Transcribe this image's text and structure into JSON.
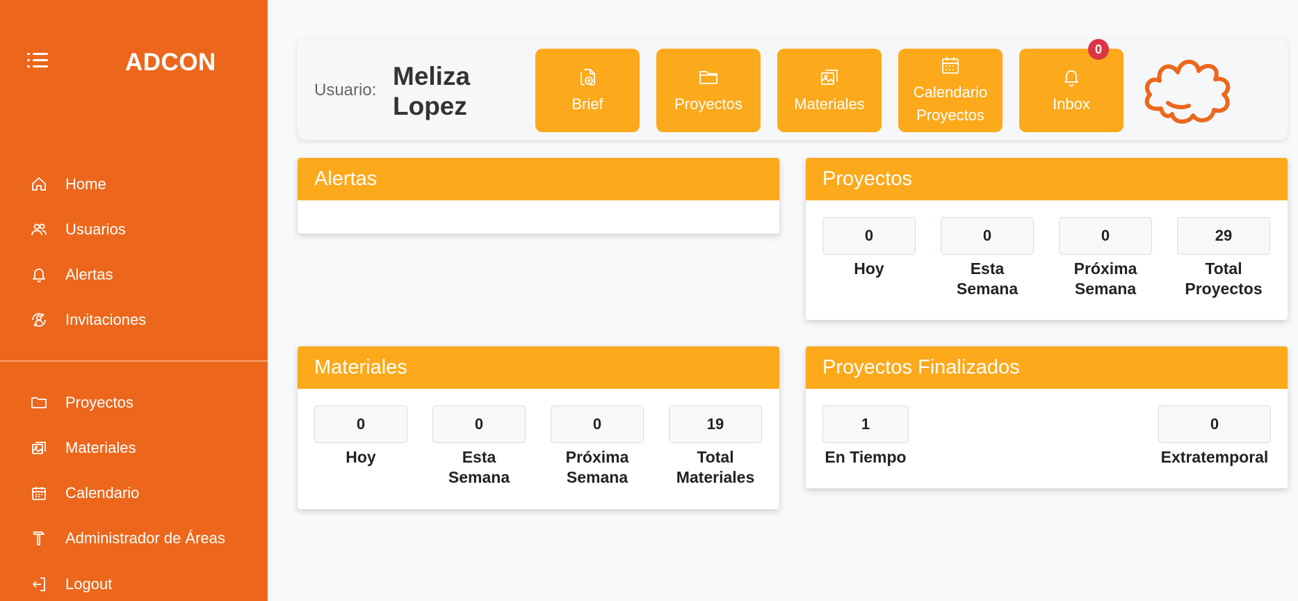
{
  "sidebar": {
    "brand": "ADCON",
    "menu_icon": "hamburger-menu-icon",
    "items_top": [
      {
        "label": "Home",
        "icon": "home-icon"
      },
      {
        "label": "Usuarios",
        "icon": "users-icon"
      },
      {
        "label": "Alertas",
        "icon": "bell-icon"
      },
      {
        "label": "Invitaciones",
        "icon": "invitations-icon"
      }
    ],
    "items_bottom": [
      {
        "label": "Proyectos",
        "icon": "folder-icon"
      },
      {
        "label": "Materiales",
        "icon": "images-icon"
      },
      {
        "label": "Calendario",
        "icon": "calendar-icon"
      },
      {
        "label": "Administrador de Áreas",
        "icon": "hammer-icon"
      },
      {
        "label": "Logout",
        "icon": "logout-icon"
      }
    ]
  },
  "header": {
    "user_label": "Usuario:",
    "user_name": "Meliza Lopez",
    "buttons": [
      {
        "label": "Brief",
        "icon": "file-add-icon"
      },
      {
        "label": "Proyectos",
        "icon": "folder-icon"
      },
      {
        "label": "Materiales",
        "icon": "images-icon"
      },
      {
        "label": "Calendario Proyectos",
        "icon": "calendar-icon"
      },
      {
        "label": "Inbox",
        "icon": "bell-icon"
      }
    ],
    "inbox_badge": "0",
    "logo": "adcon-logo-outline"
  },
  "cards": {
    "alertas": {
      "title": "Alertas"
    },
    "proyectos": {
      "title": "Proyectos",
      "stats": [
        {
          "value": "0",
          "label": "Hoy"
        },
        {
          "value": "0",
          "label": "Esta Semana"
        },
        {
          "value": "0",
          "label": "Próxima Semana"
        },
        {
          "value": "29",
          "label": "Total Proyectos"
        }
      ]
    },
    "materiales": {
      "title": "Materiales",
      "stats": [
        {
          "value": "0",
          "label": "Hoy"
        },
        {
          "value": "0",
          "label": "Esta Semana"
        },
        {
          "value": "0",
          "label": "Próxima Semana"
        },
        {
          "value": "19",
          "label": "Total Materiales"
        }
      ]
    },
    "finalizados": {
      "title": "Proyectos Finalizados",
      "stats": [
        {
          "value": "1",
          "label": "En Tiempo"
        },
        {
          "value": "0",
          "label": "Extratemporal"
        }
      ]
    }
  },
  "colors": {
    "sidebar": "#ec671c",
    "accent": "#fca91b",
    "badge": "#dc3545",
    "background": "#f8f9fb"
  }
}
